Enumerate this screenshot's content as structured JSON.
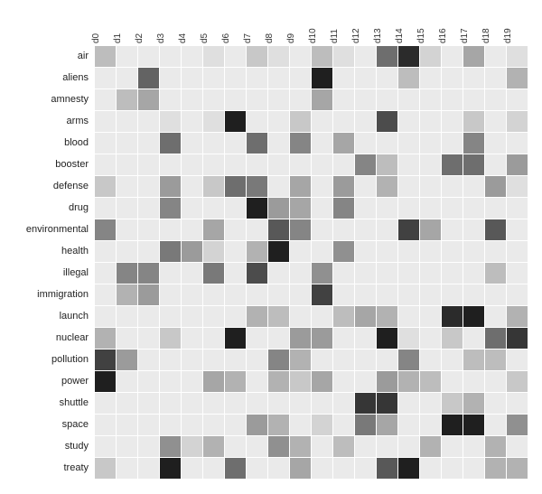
{
  "chart_data": {
    "type": "heatmap",
    "title": "",
    "xlabel": "",
    "ylabel": "",
    "columns": [
      "d0",
      "d1",
      "d2",
      "d3",
      "d4",
      "d5",
      "d6",
      "d7",
      "d8",
      "d9",
      "d10",
      "d11",
      "d12",
      "d13",
      "d14",
      "d15",
      "d16",
      "d17",
      "d18",
      "d19"
    ],
    "rows": [
      "air",
      "aliens",
      "amnesty",
      "arms",
      "blood",
      "booster",
      "defense",
      "drug",
      "environmental",
      "health",
      "illegal",
      "immigration",
      "launch",
      "nuclear",
      "pollution",
      "power",
      "shuttle",
      "space",
      "study",
      "treaty"
    ],
    "value_range": [
      0,
      1
    ],
    "values": [
      [
        0.25,
        0.05,
        0.05,
        0.05,
        0.05,
        0.1,
        0.05,
        0.2,
        0.1,
        0.05,
        0.25,
        0.1,
        0.05,
        0.6,
        0.9,
        0.15,
        0.05,
        0.35,
        0.05,
        0.1
      ],
      [
        0.05,
        0.05,
        0.65,
        0.05,
        0.05,
        0.05,
        0.05,
        0.05,
        0.05,
        0.05,
        0.95,
        0.05,
        0.05,
        0.05,
        0.25,
        0.05,
        0.05,
        0.05,
        0.05,
        0.3
      ],
      [
        0.05,
        0.25,
        0.35,
        0.05,
        0.05,
        0.05,
        0.05,
        0.05,
        0.05,
        0.05,
        0.35,
        0.05,
        0.05,
        0.05,
        0.05,
        0.05,
        0.05,
        0.05,
        0.05,
        0.05
      ],
      [
        0.05,
        0.05,
        0.05,
        0.1,
        0.05,
        0.1,
        0.95,
        0.05,
        0.05,
        0.2,
        0.05,
        0.05,
        0.05,
        0.75,
        0.05,
        0.05,
        0.05,
        0.2,
        0.05,
        0.15
      ],
      [
        0.05,
        0.05,
        0.05,
        0.6,
        0.05,
        0.05,
        0.05,
        0.6,
        0.05,
        0.5,
        0.05,
        0.35,
        0.05,
        0.05,
        0.05,
        0.05,
        0.05,
        0.5,
        0.05,
        0.05
      ],
      [
        0.05,
        0.05,
        0.05,
        0.05,
        0.05,
        0.05,
        0.05,
        0.05,
        0.05,
        0.05,
        0.05,
        0.05,
        0.5,
        0.25,
        0.05,
        0.05,
        0.6,
        0.6,
        0.05,
        0.4
      ],
      [
        0.2,
        0.05,
        0.05,
        0.4,
        0.05,
        0.2,
        0.6,
        0.55,
        0.05,
        0.35,
        0.05,
        0.4,
        0.05,
        0.3,
        0.05,
        0.05,
        0.05,
        0.05,
        0.4,
        0.1
      ],
      [
        0.05,
        0.05,
        0.05,
        0.5,
        0.05,
        0.05,
        0.05,
        0.95,
        0.4,
        0.35,
        0.05,
        0.5,
        0.05,
        0.05,
        0.05,
        0.05,
        0.05,
        0.05,
        0.05,
        0.05
      ],
      [
        0.5,
        0.05,
        0.05,
        0.05,
        0.05,
        0.35,
        0.05,
        0.05,
        0.7,
        0.5,
        0.05,
        0.05,
        0.05,
        0.05,
        0.8,
        0.35,
        0.05,
        0.05,
        0.7,
        0.05
      ],
      [
        0.05,
        0.05,
        0.05,
        0.55,
        0.4,
        0.15,
        0.05,
        0.3,
        0.95,
        0.05,
        0.05,
        0.45,
        0.05,
        0.05,
        0.05,
        0.05,
        0.05,
        0.05,
        0.05,
        0.05
      ],
      [
        0.05,
        0.5,
        0.5,
        0.05,
        0.05,
        0.55,
        0.05,
        0.75,
        0.05,
        0.05,
        0.45,
        0.05,
        0.05,
        0.05,
        0.05,
        0.05,
        0.05,
        0.05,
        0.25,
        0.05
      ],
      [
        0.05,
        0.3,
        0.4,
        0.05,
        0.05,
        0.05,
        0.05,
        0.05,
        0.05,
        0.05,
        0.8,
        0.05,
        0.05,
        0.05,
        0.05,
        0.05,
        0.05,
        0.05,
        0.05,
        0.05
      ],
      [
        0.05,
        0.05,
        0.05,
        0.05,
        0.05,
        0.05,
        0.05,
        0.3,
        0.25,
        0.05,
        0.05,
        0.25,
        0.35,
        0.3,
        0.05,
        0.05,
        0.9,
        0.95,
        0.05,
        0.3
      ],
      [
        0.3,
        0.05,
        0.05,
        0.2,
        0.05,
        0.05,
        0.95,
        0.05,
        0.05,
        0.4,
        0.4,
        0.05,
        0.05,
        0.95,
        0.1,
        0.05,
        0.2,
        0.05,
        0.6,
        0.85
      ],
      [
        0.8,
        0.4,
        0.05,
        0.05,
        0.05,
        0.05,
        0.05,
        0.05,
        0.5,
        0.3,
        0.05,
        0.05,
        0.05,
        0.05,
        0.5,
        0.05,
        0.05,
        0.25,
        0.25,
        0.05
      ],
      [
        0.95,
        0.05,
        0.05,
        0.05,
        0.05,
        0.35,
        0.3,
        0.05,
        0.3,
        0.2,
        0.35,
        0.05,
        0.05,
        0.4,
        0.3,
        0.25,
        0.05,
        0.05,
        0.05,
        0.2
      ],
      [
        0.05,
        0.05,
        0.05,
        0.05,
        0.05,
        0.05,
        0.05,
        0.05,
        0.05,
        0.05,
        0.05,
        0.05,
        0.85,
        0.85,
        0.05,
        0.05,
        0.2,
        0.3,
        0.05,
        0.05
      ],
      [
        0.05,
        0.05,
        0.05,
        0.05,
        0.05,
        0.05,
        0.05,
        0.4,
        0.3,
        0.05,
        0.15,
        0.05,
        0.55,
        0.35,
        0.05,
        0.05,
        0.95,
        0.95,
        0.05,
        0.45
      ],
      [
        0.05,
        0.05,
        0.05,
        0.45,
        0.15,
        0.3,
        0.05,
        0.05,
        0.45,
        0.3,
        0.05,
        0.25,
        0.05,
        0.05,
        0.05,
        0.3,
        0.05,
        0.05,
        0.3,
        0.05
      ],
      [
        0.2,
        0.05,
        0.05,
        0.95,
        0.05,
        0.05,
        0.6,
        0.05,
        0.05,
        0.35,
        0.05,
        0.05,
        0.05,
        0.7,
        0.95,
        0.05,
        0.05,
        0.05,
        0.3,
        0.3
      ]
    ]
  }
}
